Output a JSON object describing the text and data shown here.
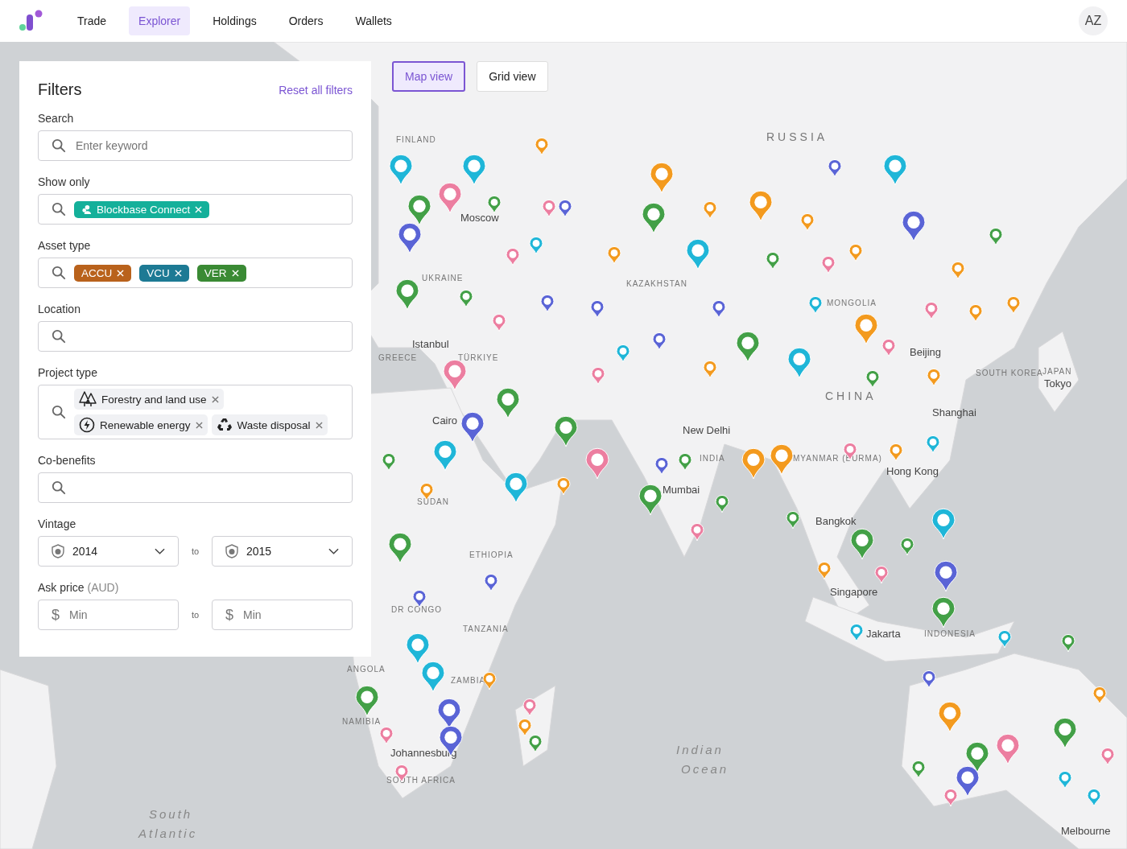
{
  "nav": {
    "tabs": [
      {
        "label": "Trade",
        "selected": false
      },
      {
        "label": "Explorer",
        "selected": true
      },
      {
        "label": "Holdings",
        "selected": false
      },
      {
        "label": "Orders",
        "selected": false
      },
      {
        "label": "Wallets",
        "selected": false
      }
    ],
    "avatar": "AZ"
  },
  "view_toggle": [
    {
      "label": "Map view",
      "selected": true
    },
    {
      "label": "Grid view",
      "selected": false
    }
  ],
  "filters": {
    "title": "Filters",
    "reset": "Reset all filters",
    "fields": [
      {
        "kind": "search",
        "label": "Search",
        "placeholder": "Enter keyword"
      },
      {
        "kind": "tags",
        "label": "Show only",
        "tags": [
          {
            "label": "Blockbase Connect",
            "color": "#14b09a"
          }
        ]
      },
      {
        "kind": "tags",
        "label": "Asset type",
        "tags": [
          {
            "label": "ACCU",
            "color": "#b9621c"
          },
          {
            "label": "VCU",
            "color": "#1d7a94"
          },
          {
            "label": "VER",
            "color": "#3a8a34"
          }
        ]
      },
      {
        "kind": "search",
        "label": "Location"
      },
      {
        "kind": "chips",
        "label": "Project type",
        "chips": [
          "Forestry and land use",
          "Renewable energy",
          "Waste disposal"
        ]
      },
      {
        "kind": "search",
        "label": "Co-benefits"
      },
      {
        "kind": "range_select",
        "label": "Vintage",
        "from": "2014",
        "separator": "to",
        "to": "2015"
      },
      {
        "kind": "range_input",
        "label": "Ask price",
        "unit": "(AUD)",
        "from": {
          "prefix": "$",
          "placeholder": "Min"
        },
        "separator": "to",
        "to": {
          "prefix": "$",
          "placeholder": "Min"
        }
      }
    ]
  },
  "map": {
    "labels": [
      {
        "text": "FINLAND",
        "kind": "country"
      },
      {
        "text": "RUSSIA",
        "kind": "big"
      },
      {
        "text": "Moscow",
        "kind": "city"
      },
      {
        "text": "UKRAINE",
        "kind": "country"
      },
      {
        "text": "KAZAKHSTAN",
        "kind": "country"
      },
      {
        "text": "Istanbul",
        "kind": "city"
      },
      {
        "text": "GREECE",
        "kind": "country"
      },
      {
        "text": "TÜRKIYE",
        "kind": "country"
      },
      {
        "text": "Cairo",
        "kind": "city"
      },
      {
        "text": "MONGOLIA",
        "kind": "country"
      },
      {
        "text": "Beijing",
        "kind": "city"
      },
      {
        "text": "CHINA",
        "kind": "big"
      },
      {
        "text": "SOUTH KOREA",
        "kind": "country"
      },
      {
        "text": "JAPAN",
        "kind": "country"
      },
      {
        "text": "Tokyo",
        "kind": "city"
      },
      {
        "text": "Shanghai",
        "kind": "city"
      },
      {
        "text": "New Delhi",
        "kind": "city"
      },
      {
        "text": "INDIA",
        "kind": "country"
      },
      {
        "text": "MYANMAR (BURMA)",
        "kind": "country"
      },
      {
        "text": "Hong Kong",
        "kind": "city"
      },
      {
        "text": "Mumbai",
        "kind": "city"
      },
      {
        "text": "SUDAN",
        "kind": "country"
      },
      {
        "text": "ETHIOPIA",
        "kind": "country"
      },
      {
        "text": "Bangkok",
        "kind": "city"
      },
      {
        "text": "Singapore",
        "kind": "city"
      },
      {
        "text": "DR CONGO",
        "kind": "country"
      },
      {
        "text": "TANZANIA",
        "kind": "country"
      },
      {
        "text": "Jakarta",
        "kind": "city"
      },
      {
        "text": "INDONESIA",
        "kind": "country"
      },
      {
        "text": "ANGOLA",
        "kind": "country"
      },
      {
        "text": "ZAMBIA",
        "kind": "country"
      },
      {
        "text": "NAMIBIA",
        "kind": "country"
      },
      {
        "text": "Johannesburg",
        "kind": "city"
      },
      {
        "text": "SOUTH AFRICA",
        "kind": "country"
      },
      {
        "text": "Indian",
        "kind": "ocean"
      },
      {
        "text": "Ocean",
        "kind": "ocean"
      },
      {
        "text": "South",
        "kind": "ocean"
      },
      {
        "text": "Atlantic",
        "kind": "ocean"
      },
      {
        "text": "Melbourne",
        "kind": "city"
      }
    ],
    "pins": [
      {
        "color": "#f39a1e"
      },
      {
        "color": "#f39a1e"
      },
      {
        "color": "#f39a1e"
      },
      {
        "color": "#1fb6d8"
      },
      {
        "color": "#5a64d6"
      },
      {
        "color": "#5a64d6"
      },
      {
        "color": "#1fb6d8"
      },
      {
        "color": "#ec7ea0"
      },
      {
        "color": "#43a047"
      },
      {
        "color": "#5a64d6"
      },
      {
        "color": "#1fb6d8"
      },
      {
        "color": "#43a047"
      },
      {
        "color": "#ec7ea0"
      },
      {
        "color": "#5a64d6"
      },
      {
        "color": "#43a047"
      },
      {
        "color": "#f39a1e"
      },
      {
        "color": "#f39a1e"
      },
      {
        "color": "#1fb6d8"
      },
      {
        "color": "#f39a1e"
      },
      {
        "color": "#ec7ea0"
      },
      {
        "color": "#1fb6d8"
      },
      {
        "color": "#43a047"
      },
      {
        "color": "#ec7ea0"
      },
      {
        "color": "#f39a1e"
      },
      {
        "color": "#f39a1e"
      },
      {
        "color": "#43a047"
      },
      {
        "color": "#43a047"
      },
      {
        "color": "#43a047"
      },
      {
        "color": "#ec7ea0"
      },
      {
        "color": "#5a64d6"
      },
      {
        "color": "#5a64d6"
      },
      {
        "color": "#5a64d6"
      },
      {
        "color": "#f39a1e"
      },
      {
        "color": "#1fb6d8"
      },
      {
        "color": "#ec7ea0"
      },
      {
        "color": "#f39a1e"
      },
      {
        "color": "#f39a1e"
      },
      {
        "color": "#43a047"
      },
      {
        "color": "#1fb6d8"
      },
      {
        "color": "#ec7ea0"
      },
      {
        "color": "#1fb6d8"
      },
      {
        "color": "#5a64d6"
      },
      {
        "color": "#ec7ea0"
      },
      {
        "color": "#43a047"
      },
      {
        "color": "#ec7ea0"
      },
      {
        "color": "#f39a1e"
      },
      {
        "color": "#43a047"
      },
      {
        "color": "#f39a1e"
      },
      {
        "color": "#43a047"
      },
      {
        "color": "#ec7ea0"
      },
      {
        "color": "#5a64d6"
      },
      {
        "color": "#1fb6d8"
      },
      {
        "color": "#1fb6d8"
      },
      {
        "color": "#43a047"
      },
      {
        "color": "#f39a1e"
      },
      {
        "color": "#f39a1e"
      },
      {
        "color": "#1fb6d8"
      },
      {
        "color": "#43a047"
      },
      {
        "color": "#5a64d6"
      },
      {
        "color": "#43a047"
      },
      {
        "color": "#ec7ea0"
      },
      {
        "color": "#f39a1e"
      },
      {
        "color": "#1fb6d8"
      },
      {
        "color": "#43a047"
      },
      {
        "color": "#f39a1e"
      },
      {
        "color": "#ec7ea0"
      },
      {
        "color": "#1fb6d8"
      },
      {
        "color": "#1fb6d8"
      },
      {
        "color": "#43a047"
      },
      {
        "color": "#f39a1e"
      },
      {
        "color": "#f39a1e"
      },
      {
        "color": "#ec7ea0"
      },
      {
        "color": "#43a047"
      },
      {
        "color": "#43a047"
      },
      {
        "color": "#5a64d6"
      },
      {
        "color": "#43a047"
      },
      {
        "color": "#ec7ea0"
      },
      {
        "color": "#1fb6d8"
      },
      {
        "color": "#ec7ea0"
      },
      {
        "color": "#1fb6d8"
      },
      {
        "color": "#5a64d6"
      },
      {
        "color": "#43a047"
      },
      {
        "color": "#5a64d6"
      },
      {
        "color": "#5a64d6"
      },
      {
        "color": "#1fb6d8"
      },
      {
        "color": "#1fb6d8"
      },
      {
        "color": "#5a64d6"
      },
      {
        "color": "#43a047"
      },
      {
        "color": "#5a64d6"
      },
      {
        "color": "#ec7ea0"
      },
      {
        "color": "#ec7ea0"
      },
      {
        "color": "#f39a1e"
      },
      {
        "color": "#ec7ea0"
      },
      {
        "color": "#f39a1e"
      },
      {
        "color": "#43a047"
      },
      {
        "color": "#43a047"
      },
      {
        "color": "#f39a1e"
      },
      {
        "color": "#ec7ea0"
      },
      {
        "color": "#43a047"
      },
      {
        "color": "#43a047"
      },
      {
        "color": "#5a64d6"
      },
      {
        "color": "#43a047"
      },
      {
        "color": "#f39a1e"
      }
    ]
  }
}
